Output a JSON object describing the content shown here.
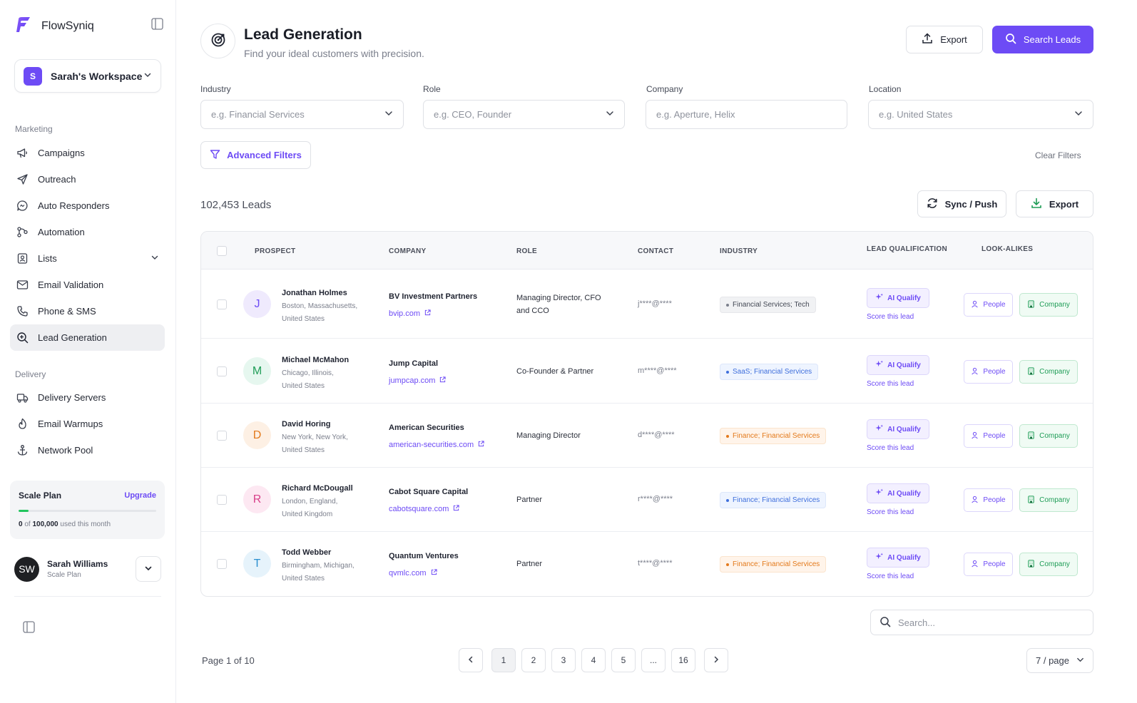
{
  "app": {
    "brand": "FlowSyniq"
  },
  "workspace": {
    "initial": "S",
    "name": "Sarah's Workspace"
  },
  "sidebar": {
    "marketing_label": "Marketing",
    "marketing_items": [
      {
        "label": "Campaigns",
        "icon": "megaphone-icon"
      },
      {
        "label": "Outreach",
        "icon": "send-icon"
      },
      {
        "label": "Auto Responders",
        "icon": "chat-bubble-icon"
      },
      {
        "label": "Automation",
        "icon": "workflow-icon"
      },
      {
        "label": "Lists",
        "icon": "contacts-list-icon"
      },
      {
        "label": "Email Validation",
        "icon": "mail-check-icon"
      },
      {
        "label": "Phone & SMS",
        "icon": "phone-icon"
      },
      {
        "label": "Lead Generation",
        "icon": "search-target-icon"
      }
    ],
    "delivery_label": "Delivery",
    "delivery_items": [
      {
        "label": "Delivery Servers",
        "icon": "truck-icon"
      },
      {
        "label": "Email Warmups",
        "icon": "flame-icon"
      },
      {
        "label": "Network Pool",
        "icon": "anchor-icon"
      }
    ],
    "plan": {
      "title": "Scale Plan",
      "upgrade": "Upgrade",
      "used": "0",
      "of_text": "of",
      "limit": "100,000",
      "suffix": "used this month",
      "progress": 0.07
    },
    "user": {
      "initials": "SW",
      "name": "Sarah Williams",
      "plan": "Scale Plan"
    }
  },
  "header": {
    "title": "Lead Generation",
    "subtitle": "Find your ideal customers with precision.",
    "export_label": "Export",
    "search_label": "Search Leads"
  },
  "filters": {
    "industry": {
      "label": "Industry",
      "placeholder": "e.g. Financial Services"
    },
    "role": {
      "label": "Role",
      "placeholder": "e.g. CEO, Founder"
    },
    "company": {
      "label": "Company",
      "placeholder": "e.g. Aperture, Helix"
    },
    "location": {
      "label": "Location",
      "placeholder": "e.g. United States"
    },
    "advanced": "Advanced Filters",
    "clear": "Clear Filters"
  },
  "results": {
    "count": "102,453 Leads",
    "sync_label": "Sync / Push",
    "export_label": "Export"
  },
  "table": {
    "headers": [
      "PROSPECT",
      "COMPANY",
      "ROLE",
      "CONTACT",
      "INDUSTRY",
      "LEAD QUALIFICATION",
      "LOOK-ALIKES"
    ],
    "ai_label": "AI Qualify",
    "score_label": "Score this lead",
    "people_label": "People",
    "company_label": "Company",
    "rows": [
      {
        "initial": "J",
        "name": "Jonathan Holmes",
        "loc1": "Boston, Massachusetts,",
        "loc2": "United States",
        "company": "BV Investment Partners",
        "url": "bvip.com",
        "role": "Managing Director, CFO and CCO",
        "contact": "j****@****",
        "industry": "Financial Services; Tech",
        "tone": "gray",
        "avatar_bg": "#efeafd",
        "avatar_fg": "#6d4bf5"
      },
      {
        "initial": "M",
        "name": "Michael McMahon",
        "loc1": "Chicago, Illinois,",
        "loc2": "United States",
        "company": "Jump Capital",
        "url": "jumpcap.com",
        "role": "Co-Founder & Partner",
        "contact": "m****@****",
        "industry": "SaaS; Financial Services",
        "tone": "blue",
        "avatar_bg": "#e6f7ef",
        "avatar_fg": "#1f9d57"
      },
      {
        "initial": "D",
        "name": "David Horing",
        "loc1": "New York, New York,",
        "loc2": "United States",
        "company": "American Securities",
        "url": "american-securities.com",
        "role": "Managing Director",
        "contact": "d****@****",
        "industry": "Finance; Financial Services",
        "tone": "orange",
        "avatar_bg": "#fdf0e4",
        "avatar_fg": "#e37a1c"
      },
      {
        "initial": "R",
        "name": "Richard McDougall",
        "loc1": "London, England,",
        "loc2": "United Kingdom",
        "company": "Cabot Square Capital",
        "url": "cabotsquare.com",
        "role": "Partner",
        "contact": "r****@****",
        "industry": "Finance; Financial Services",
        "tone": "blue",
        "avatar_bg": "#fde8f2",
        "avatar_fg": "#d9418a"
      },
      {
        "initial": "T",
        "name": "Todd Webber",
        "loc1": "Birmingham, Michigan,",
        "loc2": "United States",
        "company": "Quantum Ventures",
        "url": "qvmlc.com",
        "role": "Partner",
        "contact": "t****@****",
        "industry": "Finance; Financial Services",
        "tone": "orange",
        "avatar_bg": "#e6f3fb",
        "avatar_fg": "#2b8fcf"
      }
    ]
  },
  "footer": {
    "search_placeholder": "Search...",
    "page_info": "Page 1 of 10",
    "pages": [
      "1",
      "2",
      "3",
      "4",
      "5",
      "...",
      "16"
    ],
    "per_page": "7 / page"
  },
  "colors": {
    "accent": "#6d4bf5",
    "success": "#22c55e"
  }
}
